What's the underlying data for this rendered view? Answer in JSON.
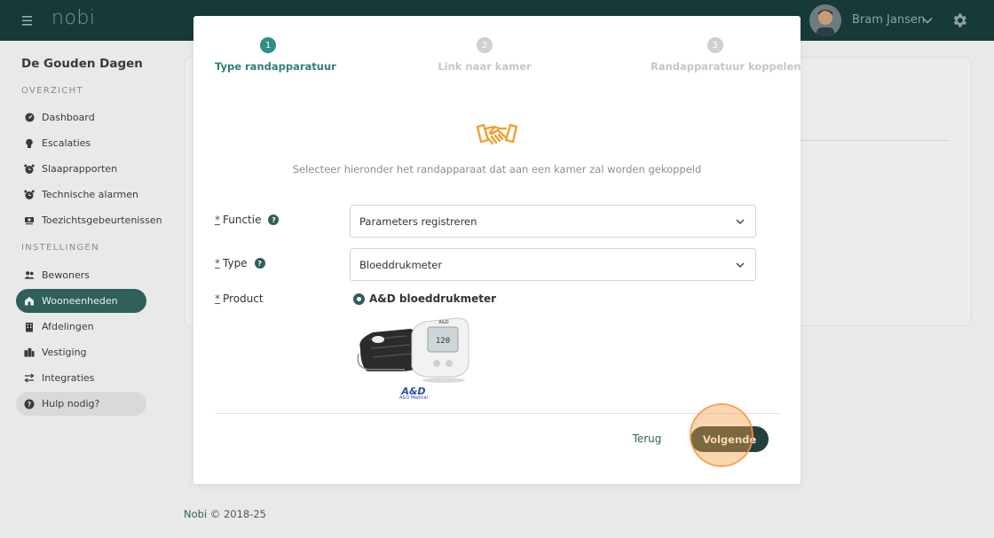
{
  "topbar": {
    "logo": "nobi",
    "user_name": "Bram Jansen"
  },
  "sidebar": {
    "org_name": "De Gouden Dagen",
    "section_overview": "OVERZICHT",
    "section_settings": "INSTELLINGEN",
    "items": [
      {
        "label": "Dashboard",
        "icon": "dashboard-icon"
      },
      {
        "label": "Escalaties",
        "icon": "lightbulb-icon"
      },
      {
        "label": "Slaaprapporten",
        "icon": "alarm-clock-icon"
      },
      {
        "label": "Technische alarmen",
        "icon": "alarm-clock-icon"
      },
      {
        "label": "Toezichtsgebeurtenissen",
        "icon": "camera-icon"
      },
      {
        "label": "Bewoners",
        "icon": "people-icon"
      },
      {
        "label": "Wooneenheden",
        "icon": "home-icon",
        "active": true
      },
      {
        "label": "Afdelingen",
        "icon": "building-icon"
      },
      {
        "label": "Vestiging",
        "icon": "buildings-icon"
      },
      {
        "label": "Integraties",
        "icon": "arrows-icon"
      },
      {
        "label": "Hulp nodig?",
        "icon": "help-icon"
      }
    ]
  },
  "footer": {
    "brand": "Nobi",
    "copyright": "© 2018-25"
  },
  "modal": {
    "steps": [
      {
        "number": "1",
        "label": "Type randapparatuur",
        "state": "active"
      },
      {
        "number": "2",
        "label": "Link naar kamer",
        "state": "inactive"
      },
      {
        "number": "3",
        "label": "Randapparatuur koppelen",
        "state": "inactive"
      }
    ],
    "intro": "Selecteer hieronder het randapparaat dat aan een kamer zal worden gekoppeld",
    "fields": {
      "required_marker": "*",
      "function_label": "Functie",
      "function_value": "Parameters registreren",
      "type_label": "Type",
      "type_value": "Bloeddrukmeter",
      "product_label": "Product",
      "product_option": "A&D bloeddrukmeter",
      "brand_logo": "A&D",
      "brand_sub": "A&D Medical"
    },
    "back_label": "Terug",
    "next_label": "Volgende"
  },
  "colors": {
    "topbar": "#173937",
    "accent": "#2f5f5b",
    "step_active": "#2f8f86",
    "icon_orange": "#f0a030",
    "click_highlight": "#f5a046"
  }
}
